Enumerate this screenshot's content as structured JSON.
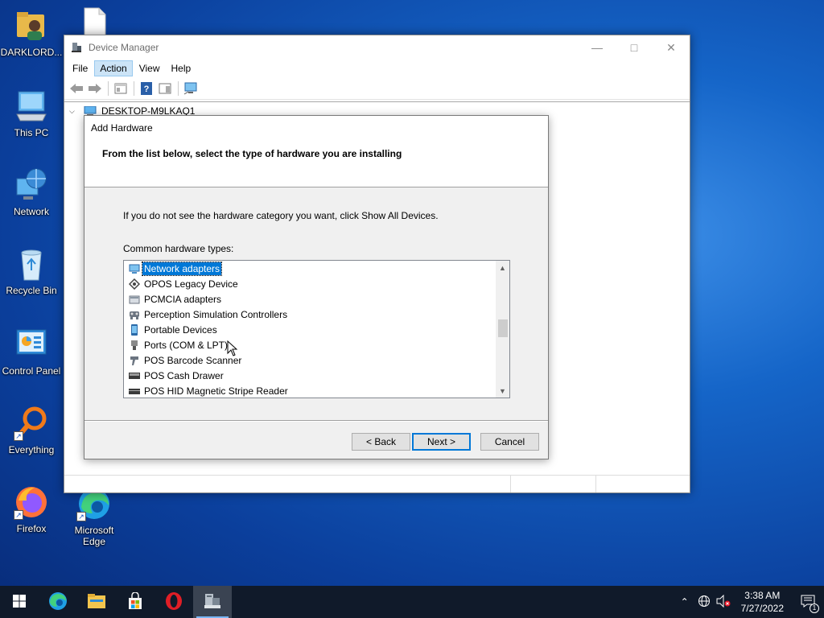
{
  "desktop": {
    "icons": [
      {
        "label": "DARKLORD...",
        "icon": "user-folder-icon"
      },
      {
        "label": "",
        "icon": "blank-file-icon"
      },
      {
        "label": "This PC",
        "icon": "computer-icon"
      },
      {
        "label": "Network",
        "icon": "network-globe-icon"
      },
      {
        "label": "Recycle Bin",
        "icon": "recycle-bin-icon"
      },
      {
        "label": "Control Panel",
        "icon": "control-panel-icon"
      },
      {
        "label": "Everything",
        "icon": "magnifier-icon"
      },
      {
        "label": "Firefox",
        "icon": "firefox-icon"
      },
      {
        "label": "Microsoft Edge",
        "icon": "edge-icon"
      }
    ]
  },
  "device_manager": {
    "title": "Device Manager",
    "menu": [
      "File",
      "Action",
      "View",
      "Help"
    ],
    "active_menu": "Action",
    "tree_root": "DESKTOP-M9LKAQ1"
  },
  "dialog": {
    "title": "Add Hardware",
    "heading": "From the list below, select the type of hardware you are installing",
    "info": "If you do not see the hardware category you want, click Show All Devices.",
    "list_label": "Common hardware types:",
    "items": [
      {
        "label": "Network adapters",
        "icon": "network-adapter-icon",
        "selected": true
      },
      {
        "label": "OPOS Legacy Device",
        "icon": "opos-device-icon",
        "selected": false
      },
      {
        "label": "PCMCIA adapters",
        "icon": "pcmcia-icon",
        "selected": false
      },
      {
        "label": "Perception Simulation Controllers",
        "icon": "perception-controller-icon",
        "selected": false
      },
      {
        "label": "Portable Devices",
        "icon": "portable-device-icon",
        "selected": false
      },
      {
        "label": "Ports (COM & LPT)",
        "icon": "port-icon",
        "selected": false
      },
      {
        "label": "POS Barcode Scanner",
        "icon": "barcode-scanner-icon",
        "selected": false
      },
      {
        "label": "POS Cash Drawer",
        "icon": "cash-drawer-icon",
        "selected": false
      },
      {
        "label": "POS HID Magnetic Stripe Reader",
        "icon": "stripe-reader-icon",
        "selected": false
      }
    ],
    "buttons": {
      "back": "< Back",
      "next": "Next >",
      "cancel": "Cancel"
    }
  },
  "taskbar": {
    "apps": [
      "start-icon",
      "edge-icon",
      "file-explorer-icon",
      "store-icon",
      "opera-icon",
      "device-manager-icon"
    ],
    "active_app": "device-manager-icon",
    "clock": {
      "time": "3:38 AM",
      "date": "7/27/2022"
    },
    "notification_count": "1"
  },
  "colors": {
    "accent": "#0078d7",
    "taskbar": "#101a2a",
    "selection": "#0078d7"
  }
}
